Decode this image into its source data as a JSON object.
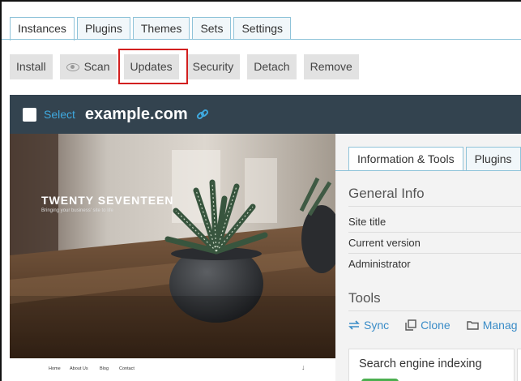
{
  "tabs": [
    "Instances",
    "Plugins",
    "Themes",
    "Sets",
    "Settings"
  ],
  "toolbar": {
    "install": "Install",
    "scan": "Scan",
    "updates": "Updates",
    "security": "Security",
    "detach": "Detach",
    "remove": "Remove"
  },
  "instance": {
    "select_label": "Select",
    "site_name": "example.com"
  },
  "preview": {
    "theme_title": "TWENTY SEVENTEEN",
    "tagline": "Bringing your business' site to life",
    "nav": [
      "Home",
      "About Us",
      "Blog",
      "Contact"
    ]
  },
  "panel": {
    "tabs": [
      "Information & Tools",
      "Plugins"
    ],
    "general_info_title": "General Info",
    "rows": [
      "Site title",
      "Current version",
      "Administrator"
    ],
    "tools_title": "Tools",
    "tools": [
      "Sync",
      "Clone",
      "Manag"
    ],
    "seo_label": "Search engine indexing"
  },
  "colors": {
    "tab_border": "#8fc3d9",
    "header_bg": "#33434f",
    "link_blue": "#3fa9df",
    "highlight": "#d21f1f",
    "toggle_green": "#4caf50"
  }
}
